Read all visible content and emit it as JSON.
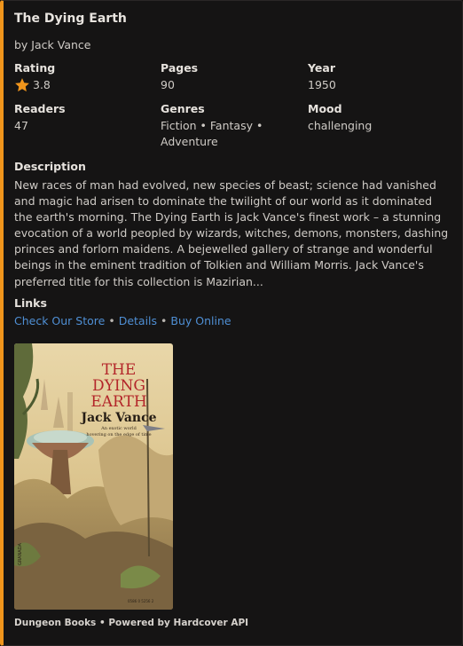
{
  "book": {
    "title": "The Dying Earth",
    "author": "by Jack Vance",
    "rating_label": "Rating",
    "rating_value": "3.8",
    "pages_label": "Pages",
    "pages_value": "90",
    "year_label": "Year",
    "year_value": "1950",
    "readers_label": "Readers",
    "readers_value": "47",
    "genres_label": "Genres",
    "genres_value": "Fiction • Fantasy • Adventure",
    "mood_label": "Mood",
    "mood_value": "challenging",
    "description_label": "Description",
    "description": "New races of man had evolved, new species of beast; science had vanished and magic had arisen to dominate the twilight of our world as it dominated the earth's morning. The Dying Earth is Jack Vance's finest work – a stunning evocation of a world peopled by wizards, witches, demons, monsters, dashing princes and forlorn maidens. A bejewelled gallery of strange and wonderful beings in the eminent tradition of Tolkien and William Morris. Jack Vance's preferred title for this collection is Mazirian..."
  },
  "links": {
    "label": "Links",
    "items": [
      "Check Our Store",
      "Details",
      "Buy Online"
    ],
    "separator": "•"
  },
  "cover": {
    "title_line1": "THE",
    "title_line2": "DYING",
    "title_line3": "EARTH",
    "author": "Jack Vance",
    "tagline_line1": "An exotic world",
    "tagline_line2": "hovering on the edge of time",
    "spine_text": "GRANADA",
    "code_text": "0586 0 5256 2"
  },
  "footer": {
    "text": "Dungeon Books • Powered by Hardcover API"
  },
  "colors": {
    "accent": "#f0951c",
    "link": "#4f8fd4",
    "background": "#151414"
  }
}
